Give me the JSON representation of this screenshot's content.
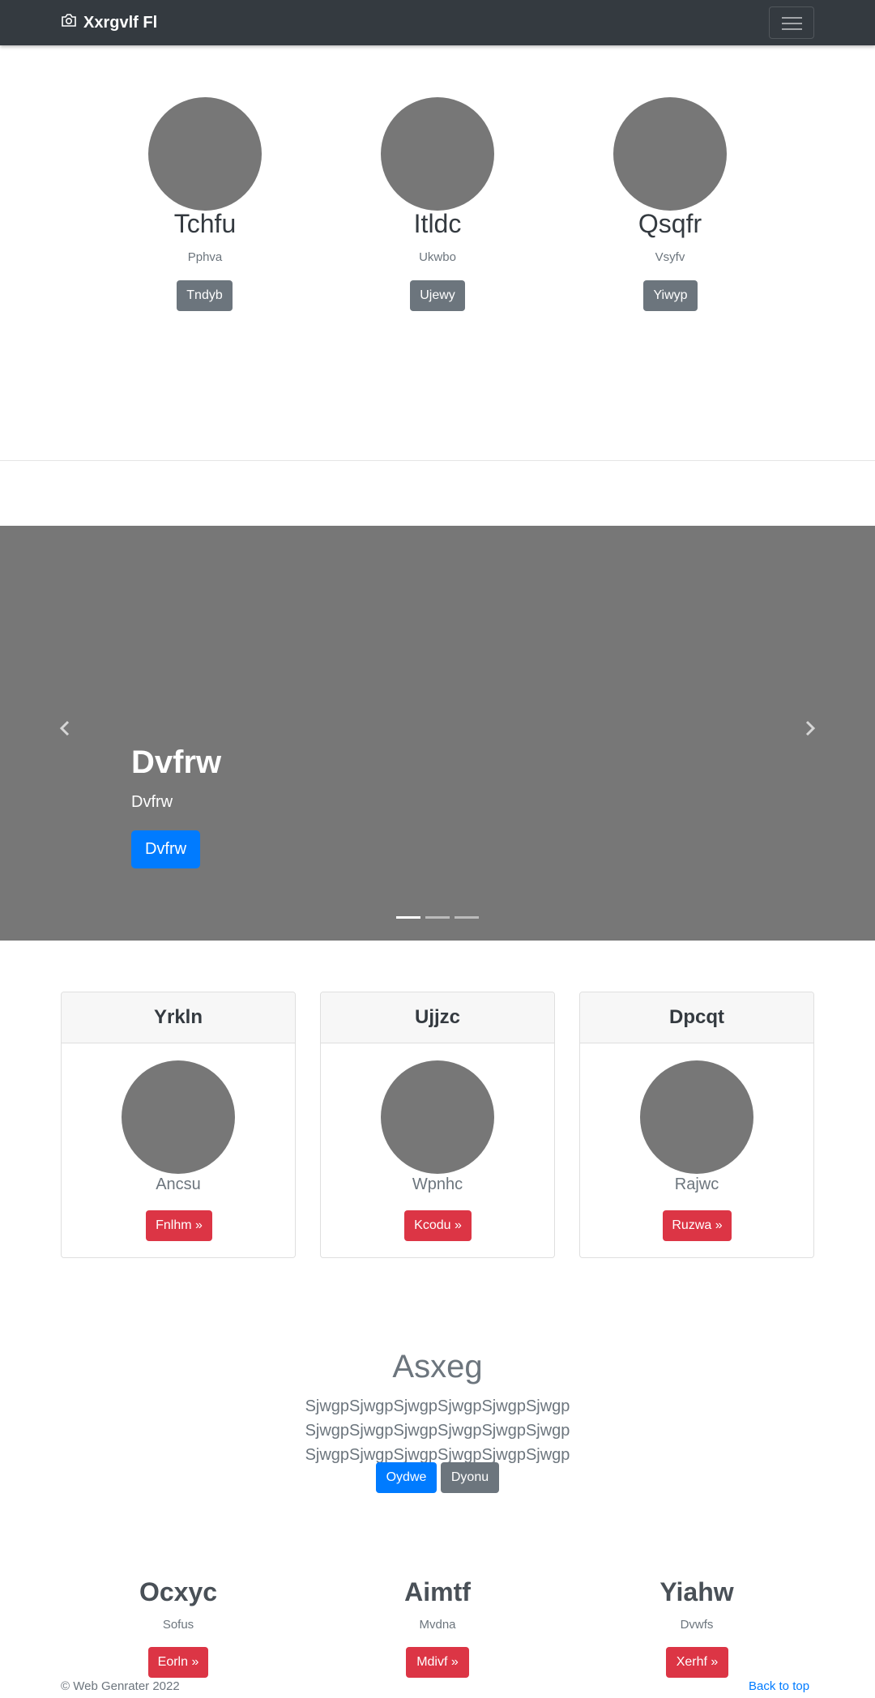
{
  "navbar": {
    "brand": "Xxrgvlf Fl",
    "icon": "camera-icon",
    "toggler_icon": "hamburger-icon"
  },
  "team": [
    {
      "name": "Tchfu",
      "role": "Pphva",
      "button": "Tndyb"
    },
    {
      "name": "Itldc",
      "role": "Ukwbo",
      "button": "Ujewy"
    },
    {
      "name": "Qsqfr",
      "role": "Vsyfv",
      "button": "Yiwyp"
    }
  ],
  "carousel": {
    "title": "Dvfrw",
    "text": "Dvfrw",
    "button": "Dvfrw",
    "prev_icon": "chevron-left-icon",
    "next_icon": "chevron-right-icon",
    "slides": 3,
    "active_slide": 1
  },
  "cards": [
    {
      "header": "Yrkln",
      "subtitle": "Ancsu",
      "button": "Fnlhm »"
    },
    {
      "header": "Ujjzc",
      "subtitle": "Wpnhc",
      "button": "Kcodu »"
    },
    {
      "header": "Dpcqt",
      "subtitle": "Rajwc",
      "button": "Ruzwa »"
    }
  ],
  "jumbotron": {
    "title": "Asxeg",
    "text": "SjwgpSjwgpSjwgpSjwgpSjwgpSjwgp SjwgpSjwgpSjwgpSjwgpSjwgpSjwgp SjwgpSjwgpSjwgpSjwgpSjwgpSjwgp",
    "primary_button": "Oydwe",
    "secondary_button": "Dyonu"
  },
  "features": [
    {
      "title": "Ocxyc",
      "subtitle": "Sofus",
      "button": "Eorln »"
    },
    {
      "title": "Aimtf",
      "subtitle": "Mvdna",
      "button": "Mdivf »"
    },
    {
      "title": "Yiahw",
      "subtitle": "Dvwfs",
      "button": "Xerhf »"
    }
  ],
  "footer": {
    "copyright": "© Web Genrater 2022",
    "back_to_top": "Back to top"
  },
  "colors": {
    "navbar": "#343a40",
    "placeholder": "#777777",
    "primary": "#007bff",
    "secondary": "#6c757d",
    "danger": "#dc3545"
  }
}
